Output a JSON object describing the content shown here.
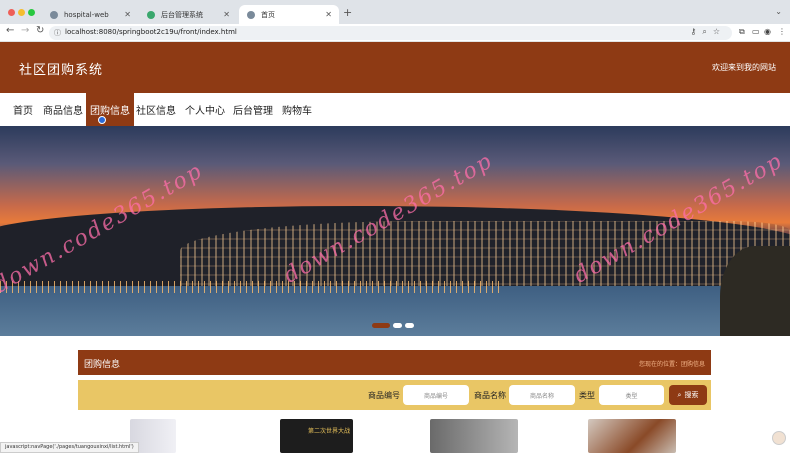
{
  "browser": {
    "tabs": [
      {
        "title": "hospital-web",
        "active": false
      },
      {
        "title": "后台管理系统",
        "active": false
      },
      {
        "title": "首页",
        "active": true
      }
    ],
    "url": "localhost:8080/springboot2c19u/front/index.html"
  },
  "header": {
    "title": "社区团购系统",
    "welcome": "欢迎来到我的网站"
  },
  "nav": {
    "items": [
      "首页",
      "商品信息",
      "团购信息",
      "社区信息",
      "个人中心",
      "后台管理",
      "购物车"
    ],
    "active_index": 2
  },
  "banner": {
    "watermark": "down.code365.top",
    "slides": 3,
    "active_slide": 0
  },
  "section": {
    "title": "团购信息",
    "breadcrumb": "您现在的位置：团购信息"
  },
  "search": {
    "fields": [
      {
        "label": "商品编号",
        "placeholder": "商品编号"
      },
      {
        "label": "商品名称",
        "placeholder": "商品名称"
      },
      {
        "label": "类型",
        "placeholder": "类型"
      }
    ],
    "button_label": "搜索"
  },
  "products": {
    "book_text": "第二次世界大战"
  },
  "status_bar": "javascript:navPage('./pages/tuangouxinxi/list.html')",
  "colors": {
    "brand": "#8e3a14",
    "search_bg": "#e9c665"
  }
}
